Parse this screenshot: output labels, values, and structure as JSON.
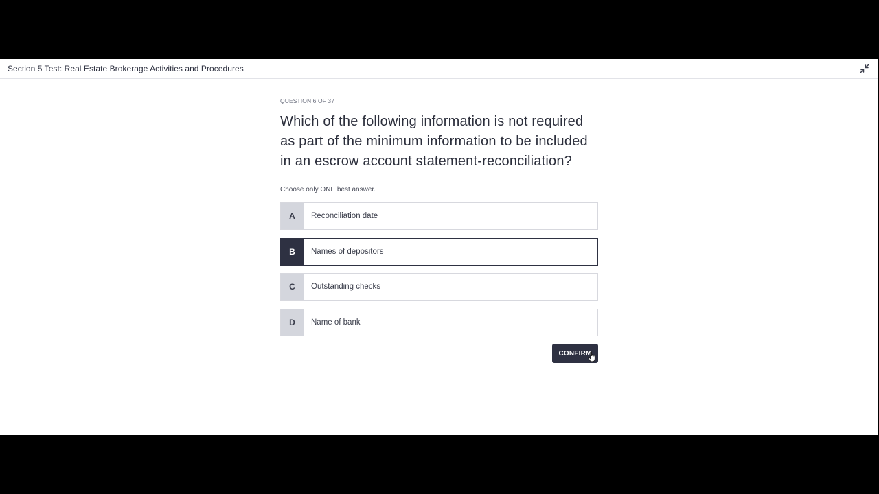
{
  "header": {
    "title": "Section 5 Test: Real Estate Brokerage Activities and Procedures",
    "collapse_icon": "collapse-arrows-icon"
  },
  "question": {
    "counter": "QUESTION 6 OF 37",
    "text": "Which of the following information is not required as part of the minimum information to be included in an escrow account statement-reconciliation?",
    "instruction": "Choose only ONE best answer."
  },
  "options": [
    {
      "letter": "A",
      "text": "Reconciliation date",
      "selected": false
    },
    {
      "letter": "B",
      "text": "Names of depositors",
      "selected": true
    },
    {
      "letter": "C",
      "text": "Outstanding checks",
      "selected": false
    },
    {
      "letter": "D",
      "text": "Name of bank",
      "selected": false
    }
  ],
  "actions": {
    "confirm_label": "CONFIRM"
  },
  "colors": {
    "accent": "#2e3142",
    "letter_bg": "#d4d6dd",
    "border": "#d7d8de"
  }
}
